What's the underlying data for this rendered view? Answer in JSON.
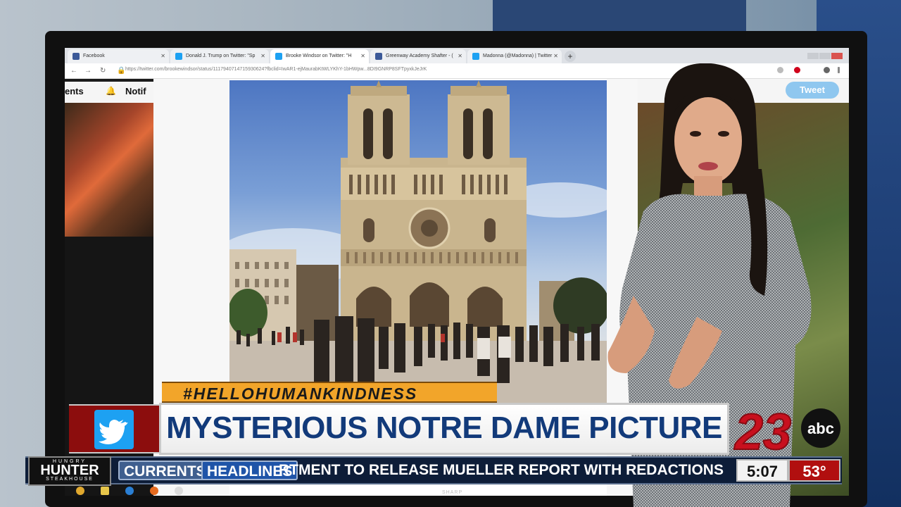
{
  "browser": {
    "tabs": [
      {
        "label": "Facebook",
        "fav_color": "#3b5998"
      },
      {
        "label": "Donald J. Trump on Twitter: \"Sp",
        "fav_color": "#1da1f2"
      },
      {
        "label": "Brooke Windsor on Twitter: \"H",
        "fav_color": "#1da1f2"
      },
      {
        "label": "Greenway Academy Shafter - (",
        "fav_color": "#3b5998"
      },
      {
        "label": "Madonna (@Madonna) | Twitter",
        "fav_color": "#1da1f2"
      }
    ],
    "url": "https://twitter.com/brookewindsor/status/1117940714715930624?fbclid=IwAR1-ejMaurabKtWLYKhY-1bHWpw...8DI9GNRP8SFTpyxkJeJrK"
  },
  "twitter": {
    "nav_fragment": "ents",
    "notifications_fragment": "Notif",
    "tweet_button": "Tweet"
  },
  "lower_third": {
    "hashtag": "#HELLOHUMANKINDNESS",
    "headline": "MYSTERIOUS NOTRE DAME PICTURE",
    "station_number": "23",
    "network": "abc"
  },
  "ticker": {
    "sponsor_top": "HUNGRY",
    "sponsor_name": "HUNTER",
    "sponsor_bottom": "STEAKHOUSE",
    "label_currents": "CURRENTS",
    "label_headlines": "HEADLINES",
    "crawl_text": "RTMENT TO RELEASE MUELLER REPORT WITH REDACTIONS THU",
    "time": "5:07",
    "temperature": "53°"
  },
  "monitor": {
    "brand": "SHARP"
  },
  "colors": {
    "headline_text": "#123a7a",
    "hashtag_bg": "#f2a52a",
    "temp_bg": "#b10f0f",
    "twitter_blue": "#1da1f2"
  }
}
